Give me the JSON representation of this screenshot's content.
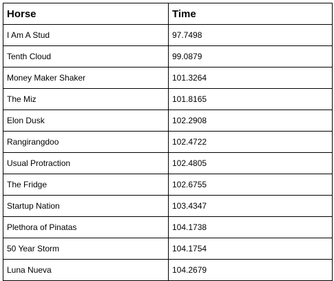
{
  "table": {
    "headers": {
      "horse": "Horse",
      "time": "Time"
    },
    "rows": [
      {
        "horse": "I Am A Stud",
        "time": "97.7498"
      },
      {
        "horse": "Tenth Cloud",
        "time": "99.0879"
      },
      {
        "horse": "Money Maker Shaker",
        "time": "101.3264"
      },
      {
        "horse": "The Miz",
        "time": "101.8165"
      },
      {
        "horse": "Elon Dusk",
        "time": "102.2908"
      },
      {
        "horse": "Rangirangdoo",
        "time": "102.4722"
      },
      {
        "horse": "Usual Protraction",
        "time": "102.4805"
      },
      {
        "horse": "The Fridge",
        "time": "102.6755"
      },
      {
        "horse": "Startup Nation",
        "time": "103.4347"
      },
      {
        "horse": "Plethora of Pinatas",
        "time": "104.1738"
      },
      {
        "horse": "50 Year Storm",
        "time": "104.1754"
      },
      {
        "horse": "Luna Nueva",
        "time": "104.2679"
      }
    ]
  }
}
